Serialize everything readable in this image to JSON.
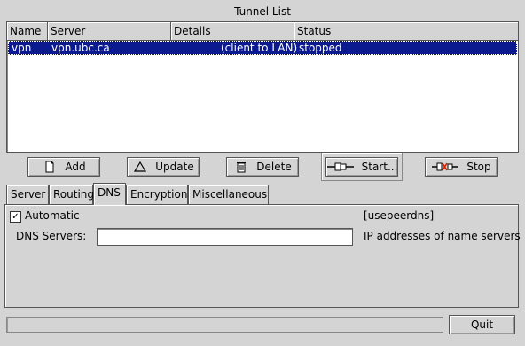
{
  "window": {
    "title": "Tunnel List"
  },
  "table": {
    "columns": [
      "Name",
      "Server",
      "Details",
      "Status"
    ],
    "rows": [
      {
        "name": "vpn",
        "server": "vpn.ubc.ca",
        "details": "(client to LAN)",
        "status": "stopped",
        "selected": true
      }
    ]
  },
  "toolbar": {
    "add_label": "Add",
    "update_label": "Update",
    "delete_label": "Delete",
    "start_label": "Start...",
    "stop_label": "Stop"
  },
  "tabs": [
    {
      "label": "Server"
    },
    {
      "label": "Routing"
    },
    {
      "label": "DNS",
      "active": true
    },
    {
      "label": "Encryption"
    },
    {
      "label": "Miscellaneous"
    }
  ],
  "dns": {
    "automatic_label": "Automatic",
    "automatic_checked": true,
    "automatic_hint": "[usepeerdns]",
    "servers_label": "DNS Servers:",
    "servers_value": "",
    "servers_hint": "IP addresses of name servers"
  },
  "footer": {
    "status_text": "",
    "quit_label": "Quit"
  },
  "colors": {
    "selection": "#0b1a8f",
    "window_bg": "#d4d4d4"
  },
  "icons": [
    "new-file-icon",
    "triangle-icon",
    "trash-icon",
    "plug-connect-icon",
    "plug-disconnect-icon",
    "checkmark-icon"
  ]
}
